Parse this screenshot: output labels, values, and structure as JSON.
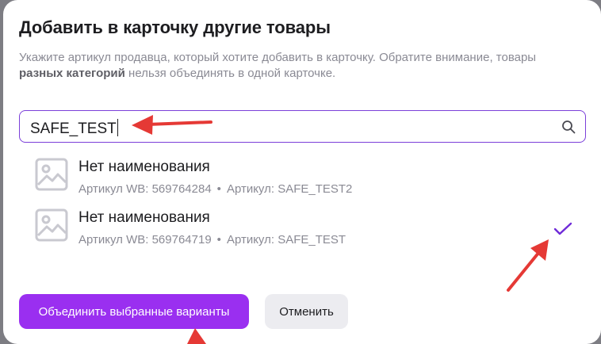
{
  "dialog": {
    "title": "Добавить в карточку другие товары",
    "description_part1": "Укажите артикул продавца, который хотите добавить в карточку. Обратите внимание, товары ",
    "description_bold": "разных категорий",
    "description_part2": " нельзя объединять в одной карточке."
  },
  "search": {
    "value": "SAFE_TEST",
    "icon": "search-icon"
  },
  "results": [
    {
      "name": "Нет наименования",
      "wb_article": "Артикул WB: 569764284",
      "separator": "•",
      "seller_article": "Артикул: SAFE_TEST2",
      "selected": false
    },
    {
      "name": "Нет наименования",
      "wb_article": "Артикул WB: 569764719",
      "separator": "•",
      "seller_article": "Артикул: SAFE_TEST",
      "selected": true
    }
  ],
  "actions": {
    "merge_label": "Объединить выбранные варианты",
    "cancel_label": "Отменить"
  },
  "colors": {
    "accent": "#9a2ff0",
    "input_border": "#7b3fd9",
    "check": "#6f2bd8",
    "annotation_arrow": "#e53935"
  }
}
